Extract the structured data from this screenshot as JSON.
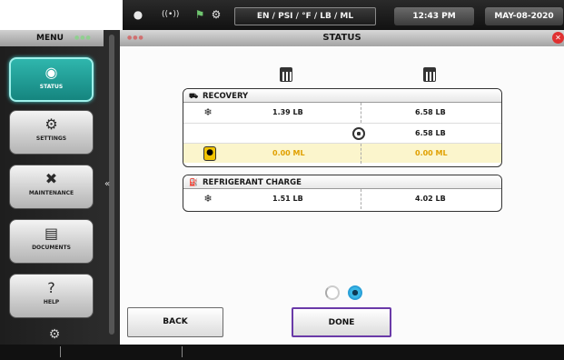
{
  "topbar": {
    "units": "EN / PSI / °F / LB / ML",
    "time": "12:43 PM",
    "date": "MAY-08-2020",
    "icons": [
      "vehicle-icon",
      "wireless-icon",
      "flag-connection-icon",
      "settings-status-icon"
    ]
  },
  "menu": {
    "title": "MENU",
    "items": [
      {
        "label": "STATUS",
        "icon": "status-icon",
        "active": true
      },
      {
        "label": "SETTINGS",
        "icon": "gear-icon"
      },
      {
        "label": "MAINTENANCE",
        "icon": "tools-icon"
      },
      {
        "label": "DOCUMENTS",
        "icon": "document-icon"
      },
      {
        "label": "HELP",
        "icon": "help-icon"
      }
    ]
  },
  "window": {
    "title": "STATUS"
  },
  "recovery": {
    "title": "RECOVERY",
    "rows": [
      {
        "icon": "snowflake-icon",
        "left": "1.39 LB",
        "right": "6.58 LB"
      },
      {
        "icon": "target-icon",
        "left": "",
        "right": "6.58 LB"
      },
      {
        "icon": "oil-icon",
        "left": "0.00 ML",
        "right": "0.00 ML"
      }
    ]
  },
  "charge": {
    "title": "REFRIGERANT CHARGE",
    "rows": [
      {
        "icon": "snowflake-icon",
        "left": "1.51 LB",
        "right": "4.02 LB"
      }
    ]
  },
  "buttons": {
    "back": "BACK",
    "done": "DONE"
  },
  "pager": {
    "pages": 2,
    "current": 2
  },
  "colors": {
    "accent_teal": "#1fa39b",
    "highlight_yellow": "#fbf5cc",
    "done_border": "#6a3aa8",
    "close_red": "#e03030"
  }
}
